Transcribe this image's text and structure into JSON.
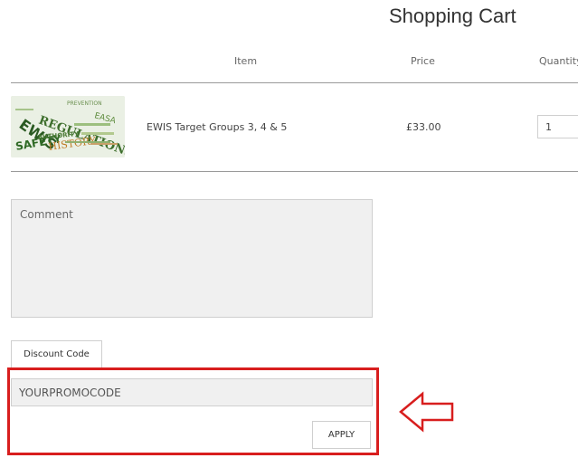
{
  "page": {
    "title": "Shopping Cart"
  },
  "table": {
    "headers": {
      "item": "Item",
      "price": "Price",
      "quantity": "Quantity"
    },
    "rows": [
      {
        "thumbnail_icon": "word-cloud-image",
        "thumbnail_words": [
          "REGULATIONS",
          "EWIS",
          "SAFETY",
          "HISTORY",
          "AUTHORITY",
          "PREVENTION",
          "EASA"
        ],
        "name": "EWIS Target Groups 3, 4 & 5",
        "price": "£33.00",
        "quantity": "1"
      }
    ]
  },
  "comment": {
    "placeholder": "Comment"
  },
  "discount": {
    "tab_label": "Discount Code",
    "promo_placeholder": "YOURPROMOCODE",
    "apply_label": "APPLY"
  },
  "annotation": {
    "highlight_color": "#d81e1e",
    "arrow_icon": "left-arrow-outline-icon"
  }
}
